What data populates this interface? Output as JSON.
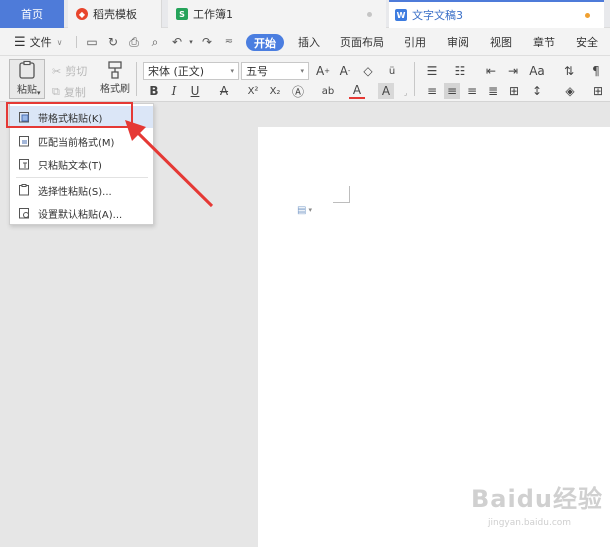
{
  "tabs": {
    "home": "首页",
    "template": "稻壳模板",
    "workbook": "工作簿1",
    "document": "文字文稿3"
  },
  "menu": {
    "file": "文件",
    "start": "开始",
    "insert": "插入",
    "layout": "页面布局",
    "reference": "引用",
    "review": "审阅",
    "view": "视图",
    "section": "章节",
    "security": "安全"
  },
  "ribbon": {
    "paste": "粘贴",
    "cut": "剪切",
    "copy": "复制",
    "format_painter": "格式刷",
    "font_name": "宋体 (正文)",
    "font_size": "五号",
    "bold": "B",
    "italic": "I",
    "underline": "U",
    "superscript": "X²",
    "subscript": "X₂",
    "font_color": "A",
    "char_shading": "A"
  },
  "paste_menu": {
    "items": [
      "带格式粘贴(K)",
      "匹配当前格式(M)",
      "只粘贴文本(T)",
      "选择性粘贴(S)...",
      "设置默认粘贴(A)..."
    ]
  },
  "watermark": {
    "brand": "Baidu经验",
    "url": "jingyan.baidu.com"
  },
  "colors": {
    "accent": "#4e7bd9",
    "highlight_red": "#e53935"
  }
}
